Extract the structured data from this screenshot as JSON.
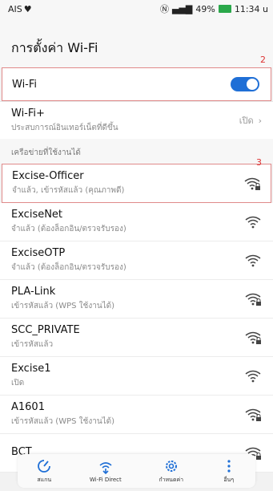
{
  "status": {
    "carrier": "AIS",
    "battery_pct": "49%",
    "time": "11:34 u",
    "signal": "▄▅▇"
  },
  "title": "การตั้งค่า Wi-Fi",
  "annotations": {
    "a2": "2",
    "a3": "3"
  },
  "wifi_toggle": {
    "label": "Wi-Fi",
    "state": "on"
  },
  "wifi_plus": {
    "label": "Wi-Fi+",
    "desc": "ประสบการณ์อินเทอร์เน็ตที่ดีขึ้น",
    "value": "เปิด"
  },
  "section": "เครือข่ายที่ใช้งานได้",
  "networks": [
    {
      "name": "Excise-Officer",
      "desc": "จำแล้ว, เข้ารหัสแล้ว (คุณภาพดี)",
      "locked": true
    },
    {
      "name": "ExciseNet",
      "desc": "จำแล้ว (ต้องล็อกอิน/ตรวจรับรอง)",
      "locked": false
    },
    {
      "name": "ExciseOTP",
      "desc": "จำแล้ว (ต้องล็อกอิน/ตรวจรับรอง)",
      "locked": false
    },
    {
      "name": "PLA-Link",
      "desc": "เข้ารหัสแล้ว (WPS ใช้งานได้)",
      "locked": true
    },
    {
      "name": "SCC_PRIVATE",
      "desc": "เข้ารหัสแล้ว",
      "locked": true
    },
    {
      "name": "Excise1",
      "desc": "เปิด",
      "locked": false
    },
    {
      "name": "A1601",
      "desc": "เข้ารหัสแล้ว (WPS ใช้งานได้)",
      "locked": true
    },
    {
      "name": "BCT",
      "desc": "",
      "locked": true
    }
  ],
  "bottom": {
    "scan": "สแกน",
    "direct": "Wi-Fi Direct",
    "config": "กำหนดค่า",
    "more": "อื่นๆ"
  },
  "colors": {
    "accent": "#1f6fd6",
    "highlight": "#e08a8a"
  }
}
